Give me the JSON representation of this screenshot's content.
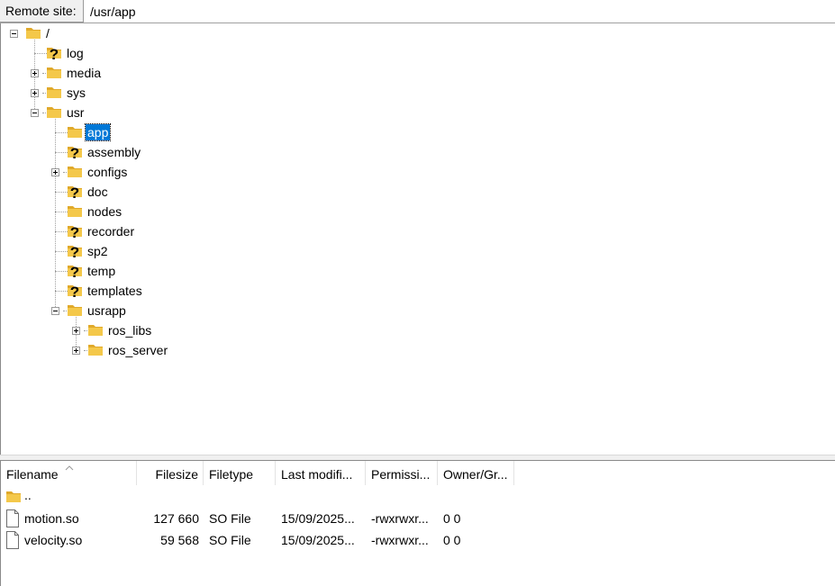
{
  "remote_site": {
    "label": "Remote site:",
    "path": "/usr/app"
  },
  "tree": [
    {
      "id": "root",
      "label": "/",
      "icon": "folder-icon",
      "depth": 0,
      "expander": "minus"
    },
    {
      "id": "log",
      "label": "log",
      "icon": "unknown-folder-icon",
      "depth": 1,
      "expander": "none"
    },
    {
      "id": "media",
      "label": "media",
      "icon": "folder-icon",
      "depth": 1,
      "expander": "plus"
    },
    {
      "id": "sys",
      "label": "sys",
      "icon": "folder-icon",
      "depth": 1,
      "expander": "plus"
    },
    {
      "id": "usr",
      "label": "usr",
      "icon": "folder-icon",
      "depth": 1,
      "expander": "minus"
    },
    {
      "id": "app",
      "label": "app",
      "icon": "folder-icon",
      "depth": 2,
      "expander": "none",
      "selected": true
    },
    {
      "id": "assembly",
      "label": "assembly",
      "icon": "unknown-folder-icon",
      "depth": 2,
      "expander": "none"
    },
    {
      "id": "configs",
      "label": "configs",
      "icon": "folder-icon",
      "depth": 2,
      "expander": "plus"
    },
    {
      "id": "doc",
      "label": "doc",
      "icon": "unknown-folder-icon",
      "depth": 2,
      "expander": "none"
    },
    {
      "id": "nodes",
      "label": "nodes",
      "icon": "folder-icon",
      "depth": 2,
      "expander": "none"
    },
    {
      "id": "recorder",
      "label": "recorder",
      "icon": "unknown-folder-icon",
      "depth": 2,
      "expander": "none"
    },
    {
      "id": "sp2",
      "label": "sp2",
      "icon": "unknown-folder-icon",
      "depth": 2,
      "expander": "none"
    },
    {
      "id": "temp",
      "label": "temp",
      "icon": "unknown-folder-icon",
      "depth": 2,
      "expander": "none"
    },
    {
      "id": "templates",
      "label": "templates",
      "icon": "unknown-folder-icon",
      "depth": 2,
      "expander": "none"
    },
    {
      "id": "usrapp",
      "label": "usrapp",
      "icon": "folder-icon",
      "depth": 2,
      "expander": "minus"
    },
    {
      "id": "ros_libs",
      "label": "ros_libs",
      "icon": "folder-icon",
      "depth": 3,
      "expander": "plus"
    },
    {
      "id": "ros_server",
      "label": "ros_server",
      "icon": "folder-icon",
      "depth": 3,
      "expander": "plus"
    }
  ],
  "file_list": {
    "sort_indicator": "sort-ascending-icon",
    "columns": [
      {
        "key": "filename",
        "label": "Filename"
      },
      {
        "key": "filesize",
        "label": "Filesize"
      },
      {
        "key": "filetype",
        "label": "Filetype"
      },
      {
        "key": "modified",
        "label": "Last modifi..."
      },
      {
        "key": "permissions",
        "label": "Permissi..."
      },
      {
        "key": "owner",
        "label": "Owner/Gr..."
      }
    ],
    "rows": [
      {
        "icon": "folder-icon",
        "filename": "..",
        "filesize": "",
        "filetype": "",
        "modified": "",
        "permissions": "",
        "owner": ""
      },
      {
        "icon": "file-icon",
        "filename": "motion.so",
        "filesize": "127 660",
        "filetype": "SO File",
        "modified": "15/09/2025...",
        "permissions": "-rwxrwxr...",
        "owner": "0 0"
      },
      {
        "icon": "file-icon",
        "filename": "velocity.so",
        "filesize": "59 568",
        "filetype": "SO File",
        "modified": "15/09/2025...",
        "permissions": "-rwxrwxr...",
        "owner": "0 0"
      }
    ]
  },
  "colors": {
    "selection": "#0078d7",
    "folder": "#f4c84a",
    "folder_dark": "#e0a92a"
  }
}
